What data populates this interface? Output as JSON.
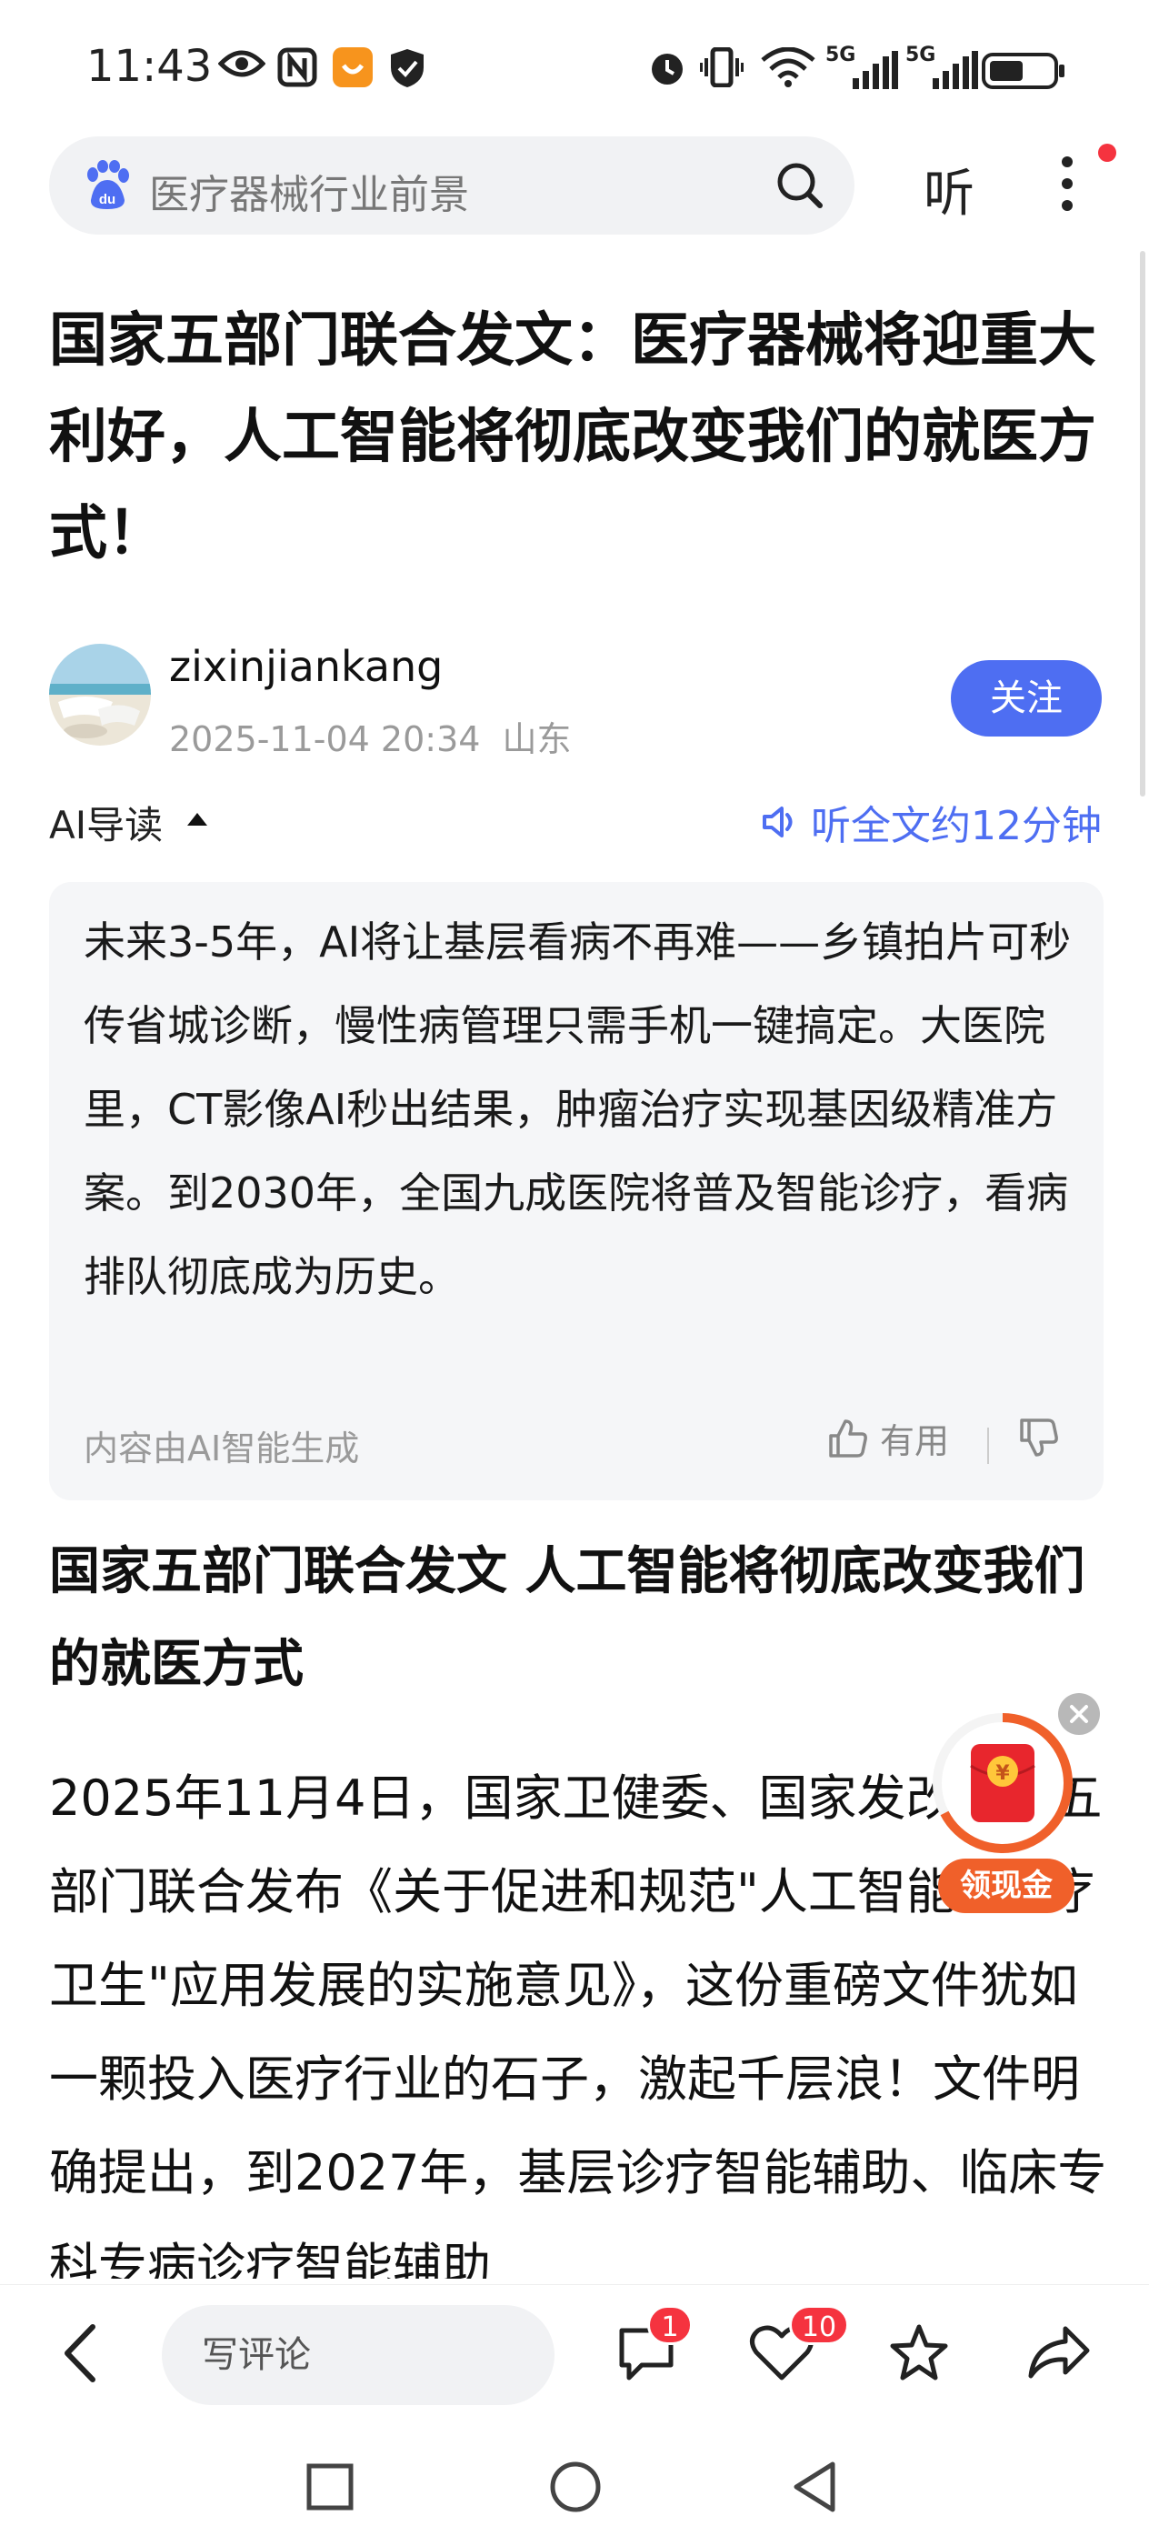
{
  "status_bar": {
    "time": "11:43",
    "network_1": "5G",
    "network_2": "5G"
  },
  "search": {
    "query": "医疗器械行业前景",
    "listen_label": "听"
  },
  "article": {
    "title": "国家五部门联合发文：医疗器械将迎重大利好，人工智能将彻底改变我们的就医方式！",
    "author": {
      "name": "zixinjiankang",
      "date": "2025-11-04 20:34",
      "location": "山东",
      "follow_label": "关注"
    },
    "ai_guide": {
      "label": "AI导读",
      "listen_full": "听全文约12分钟",
      "summary": "未来3-5年，AI将让基层看病不再难——乡镇拍片可秒传省城诊断，慢性病管理只需手机一键搞定。大医院里，CT影像AI秒出结果，肿瘤治疗实现基因级精准方案。到2030年，全国九成医院将普及智能诊疗，看病排队彻底成为历史。",
      "source": "内容由AI智能生成",
      "useful_label": "有用"
    },
    "section_heading": "国家五部门联合发文 人工智能将彻底改变我们的就医方式",
    "body": "2025年11月4日，国家卫健委、国家发改委等五部门联合发布《关于促进和规范\"人工智能+医疗卫生\"应用发展的实施意见》，这份重磅文件犹如一颗投入医疗行业的石子，激起千层浪！文件明确提出，到2027年，基层诊疗智能辅助、临床专科专病诊疗智能辅助"
  },
  "cash_widget": {
    "label": "领现金",
    "coin_symbol": "¥"
  },
  "bottom_bar": {
    "comment_placeholder": "写评论",
    "comment_count": "1",
    "like_count": "10"
  },
  "colors": {
    "accent_blue": "#4e6ef2",
    "badge_red": "#f5333f",
    "cash_orange": "#f0602a"
  }
}
